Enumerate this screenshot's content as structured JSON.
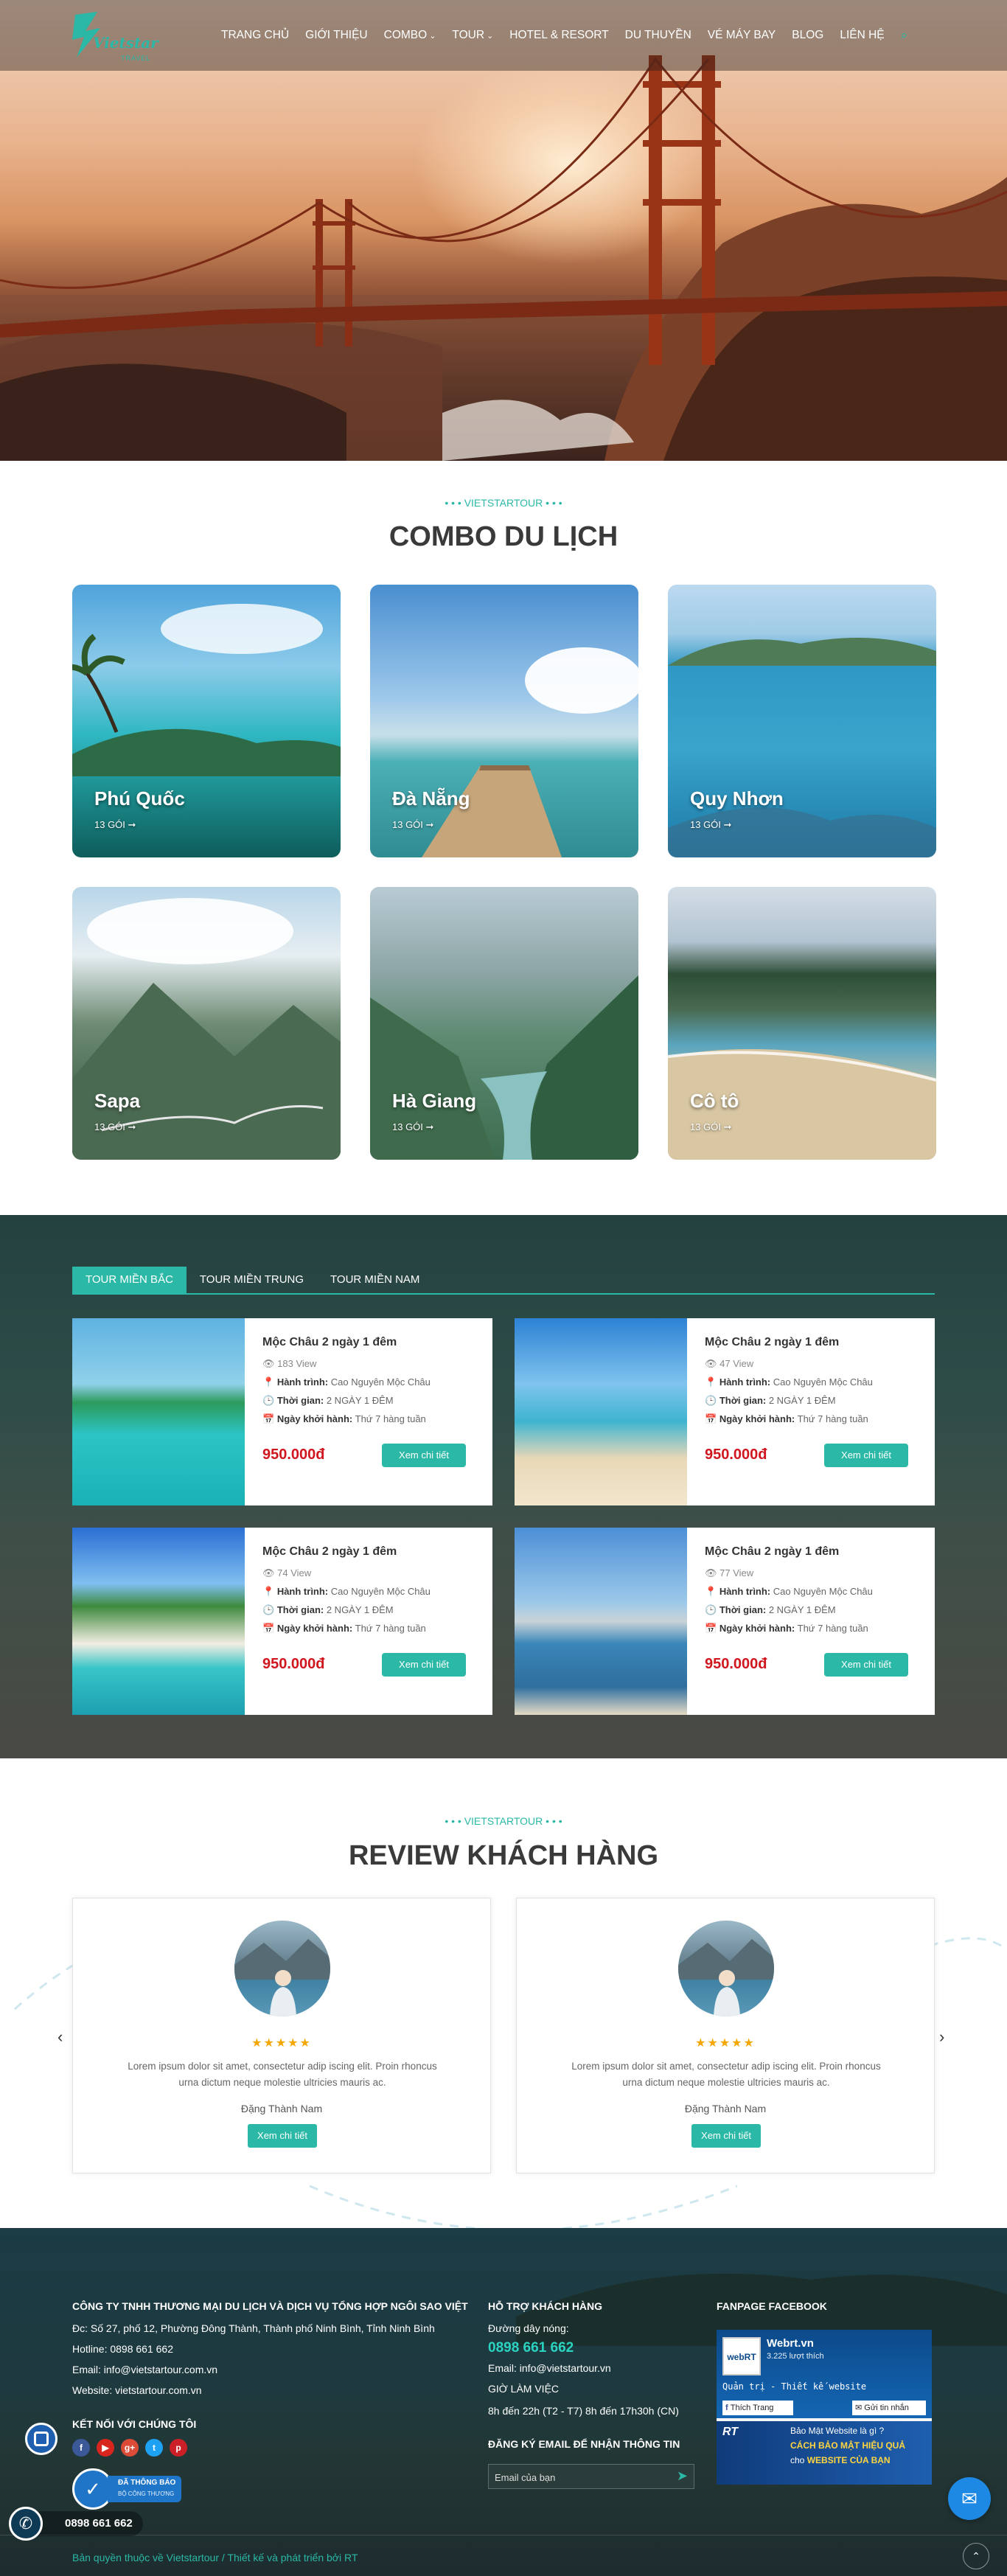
{
  "header": {
    "logo_text": "Vietstar",
    "logo_sub": "TRAVEL"
  },
  "nav": {
    "items": [
      {
        "label": "TRANG CHỦ"
      },
      {
        "label": "GIỚI THIỆU"
      },
      {
        "label": "COMBO",
        "dropdown": true
      },
      {
        "label": "TOUR",
        "dropdown": true
      },
      {
        "label": "HOTEL & RESORT"
      },
      {
        "label": "DU THUYỀN"
      },
      {
        "label": "VÉ MÁY BAY"
      },
      {
        "label": "BLOG"
      },
      {
        "label": "LIÊN HỆ"
      }
    ],
    "search_icon": "search-icon"
  },
  "combo": {
    "label": "VIETSTARTOUR",
    "title": "COMBO DU LỊCH",
    "cards": [
      {
        "name": "Phú Quốc",
        "count": "13 GÓI"
      },
      {
        "name": "Đà Nẵng",
        "count": "13 GÓI"
      },
      {
        "name": "Quy Nhơn",
        "count": "13 GÓI"
      },
      {
        "name": "Sapa",
        "count": "13 GÓI"
      },
      {
        "name": "Hà Giang",
        "count": "13 GÓI"
      },
      {
        "name": "Cô tô",
        "count": "13 GÓI"
      }
    ]
  },
  "tours": {
    "tabs": [
      {
        "label": "TOUR MIỀN BẮC",
        "active": true
      },
      {
        "label": "TOUR MIỀN TRUNG",
        "active": false
      },
      {
        "label": "TOUR MIỀN NAM",
        "active": false
      }
    ],
    "itinerary_label": "Hành trình:",
    "duration_label": "Thời gian:",
    "departure_label": "Ngày khởi hành:",
    "button_label": "Xem chi tiết",
    "items": [
      {
        "title": "Mộc Châu 2 ngày 1 đêm",
        "views": "183 View",
        "itinerary": "Cao Nguyên Mộc Châu",
        "duration": "2 NGÀY 1 ĐÊM",
        "departure": "Thứ 7 hàng tuần",
        "price": "950.000đ"
      },
      {
        "title": "Mộc Châu 2 ngày 1 đêm",
        "views": "47 View",
        "itinerary": "Cao Nguyên Mộc Châu",
        "duration": "2 NGÀY 1 ĐÊM",
        "departure": "Thứ 7 hàng tuần",
        "price": "950.000đ"
      },
      {
        "title": "Mộc Châu 2 ngày 1 đêm",
        "views": "74 View",
        "itinerary": "Cao Nguyên Mộc Châu",
        "duration": "2 NGÀY 1 ĐÊM",
        "departure": "Thứ 7 hàng tuần",
        "price": "950.000đ"
      },
      {
        "title": "Mộc Châu 2 ngày 1 đêm",
        "views": "77 View",
        "itinerary": "Cao Nguyên Mộc Châu",
        "duration": "2 NGÀY 1 ĐÊM",
        "departure": "Thứ 7 hàng tuần",
        "price": "950.000đ"
      }
    ]
  },
  "reviews": {
    "label": "VIETSTARTOUR",
    "title": "REVIEW KHÁCH HÀNG",
    "button_label": "Xem chi tiết",
    "items": [
      {
        "stars": "★★★★★",
        "text": "Lorem ipsum dolor sit amet, consectetur adip iscing elit. Proin rhoncus urna dictum neque molestie ultricies mauris ac.",
        "name": "Đặng Thành Nam"
      },
      {
        "stars": "★★★★★",
        "text": "Lorem ipsum dolor sit amet, consectetur adip iscing elit. Proin rhoncus urna dictum neque molestie ultricies mauris ac.",
        "name": "Đặng Thành Nam"
      }
    ]
  },
  "footer": {
    "company": "CÔNG TY TNHH THƯƠNG MẠI DU LỊCH VÀ DỊCH VỤ TỔNG HỢP NGÔI SAO VIỆT",
    "address": "Đc: Số 27, phố 12, Phường Đông Thành, Thành phố Ninh Bình, Tỉnh Ninh Bình",
    "hotline": "Hotline: 0898 661 662",
    "email": "Email: info@vietstartour.com.vn",
    "website": "Website: vietstartour.com.vn",
    "social_title": "KẾT NỐI VỚI CHÚNG TÔI",
    "badge_top": "ĐÃ THÔNG BÁO",
    "badge_bottom": "BỘ CÔNG THƯƠNG",
    "support_title": "HỖ TRỢ KHÁCH HÀNG",
    "support_line": "Đường dây nóng:",
    "support_phone": "0898 661 662",
    "support_email": "Email: info@vietstartour.vn",
    "hours_title": "GIỜ LÀM VIỆC",
    "hours": "8h đến 22h (T2 - T7) 8h đến 17h30h (CN)",
    "newsletter_title": "ĐĂNG KÝ EMAIL ĐỂ NHẬN THÔNG TIN",
    "newsletter_placeholder": "Email của bạn",
    "fanpage_title": "FANPAGE FACEBOOK",
    "fb_page_name": "Webrt.vn",
    "fb_likes": "3.225 lượt thích",
    "fb_like_btn": "Thích Trang",
    "fb_msg_btn": "Gửi tin nhắn",
    "fb_banner1": "Quản trị - Thiết kế website",
    "fb_post_title": "Bảo Mật Website là gì ?",
    "fb_post_line1": "CÁCH BẢO MẬT HIỆU QUẢ",
    "fb_post_line2_a": "cho",
    "fb_post_line2_b": "WEBSITE CỦA BẠN",
    "copyright": "Bản quyền thuộc về Vietstartour / Thiết kế và phát triển bởi RT",
    "float_phone": "0898 661 662"
  }
}
